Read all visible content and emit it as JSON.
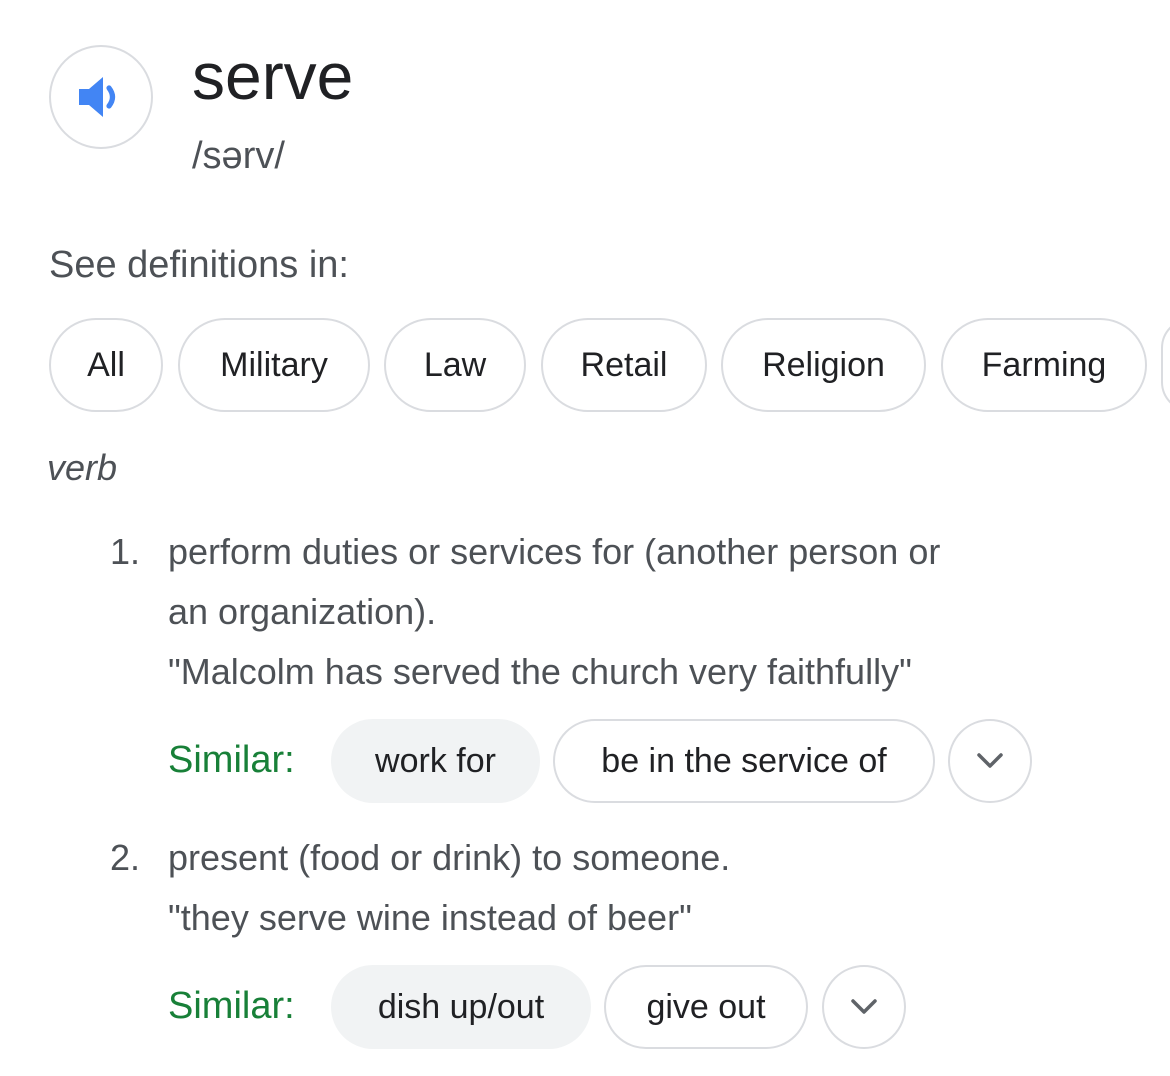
{
  "entry": {
    "word": "serve",
    "pronunciation": "/sərv/",
    "audio_icon": "speaker-icon"
  },
  "see_definitions": {
    "label": "See definitions in:",
    "chips": [
      "All",
      "Military",
      "Law",
      "Retail",
      "Religion",
      "Farming"
    ]
  },
  "part_of_speech": "verb",
  "senses": [
    {
      "number": "1.",
      "definition_line1": "perform duties or services for (another person or",
      "definition_line2": "an organization).",
      "example": "\"Malcolm has served the church very faithfully\"",
      "similar_label": "Similar:",
      "similar": [
        "work for",
        "be in the service of"
      ],
      "expand_icon": "chevron-down-icon"
    },
    {
      "number": "2.",
      "definition_line1": "present (food or drink) to someone.",
      "example": "\"they serve wine instead of beer\"",
      "similar_label": "Similar:",
      "similar": [
        "dish up/out",
        "give out"
      ],
      "expand_icon": "chevron-down-icon"
    }
  ],
  "colors": {
    "accent_blue": "#4285f4",
    "similar_green": "#188038",
    "text_secondary": "#4d5156",
    "border": "#dadce0",
    "chip_fill": "#f1f3f4"
  }
}
